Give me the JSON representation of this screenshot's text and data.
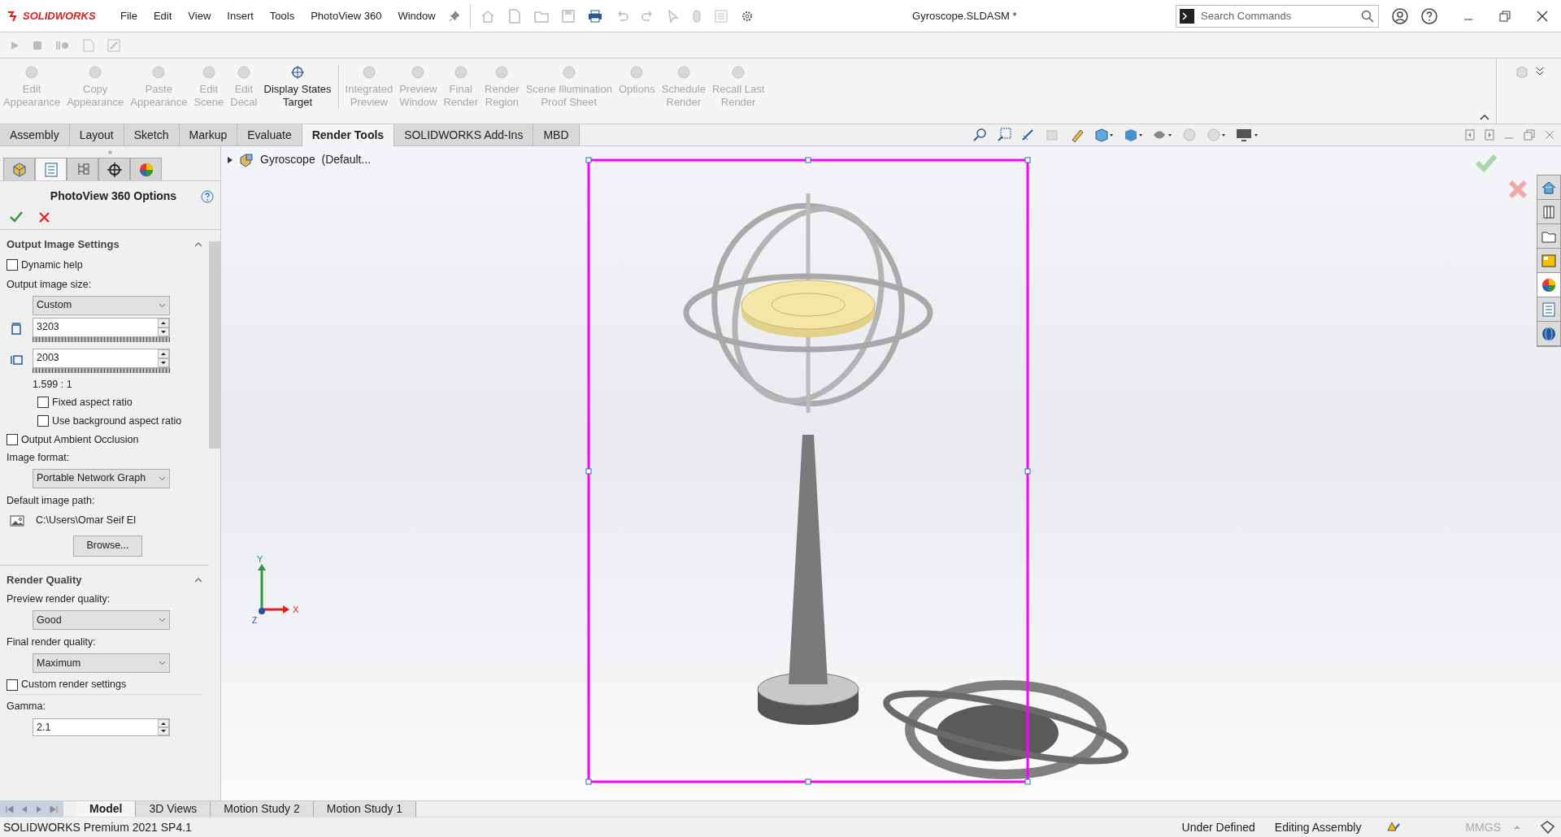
{
  "app": {
    "logo": "SOLIDWORKS",
    "menu": [
      "File",
      "Edit",
      "View",
      "Insert",
      "Tools",
      "PhotoView 360",
      "Window"
    ],
    "document_title": "Gyroscope.SLDASM *",
    "search": {
      "placeholder": "Search Commands"
    }
  },
  "ribbon": [
    {
      "label": "Edit Appearance",
      "disabled": true
    },
    {
      "label": "Copy Appearance",
      "disabled": true
    },
    {
      "label": "Paste Appearance",
      "disabled": true
    },
    {
      "label": "Edit Scene",
      "disabled": true
    },
    {
      "label": "Edit Decal",
      "disabled": true
    },
    {
      "label": "Display States Target",
      "disabled": false
    },
    {
      "label": "Integrated Preview",
      "disabled": true
    },
    {
      "label": "Preview Window",
      "disabled": true
    },
    {
      "label": "Final Render",
      "disabled": true
    },
    {
      "label": "Render Region",
      "disabled": true
    },
    {
      "label": "Scene Illumination Proof Sheet",
      "disabled": true
    },
    {
      "label": "Options",
      "disabled": true
    },
    {
      "label": "Schedule Render",
      "disabled": true
    },
    {
      "label": "Recall Last Render",
      "disabled": true
    }
  ],
  "command_tabs": [
    {
      "label": "Assembly",
      "selected": false
    },
    {
      "label": "Layout",
      "selected": false
    },
    {
      "label": "Sketch",
      "selected": false
    },
    {
      "label": "Markup",
      "selected": false
    },
    {
      "label": "Evaluate",
      "selected": false
    },
    {
      "label": "Render Tools",
      "selected": true
    },
    {
      "label": "SOLIDWORKS Add-Ins",
      "selected": false
    },
    {
      "label": "MBD",
      "selected": false
    }
  ],
  "panel_tabs": [
    {
      "selected": false
    },
    {
      "selected": true
    },
    {
      "selected": false
    },
    {
      "selected": false
    },
    {
      "selected": false
    }
  ],
  "property_manager": {
    "title": "PhotoView 360 Options",
    "output_image_settings": {
      "heading": "Output Image Settings",
      "dynamic_help": {
        "label": "Dynamic help",
        "checked": false
      },
      "size_label": "Output image size:",
      "size_value": "Custom",
      "height_value": "3203",
      "width_value": "2003",
      "ratio": "1.599 : 1",
      "fixed_aspect": {
        "label": "Fixed aspect ratio",
        "checked": false
      },
      "background_aspect": {
        "label": "Use background aspect ratio",
        "checked": false
      },
      "ambient_occlusion": {
        "label": "Output Ambient Occlusion",
        "checked": false
      },
      "format_label": "Image format:",
      "format_value": "Portable Network Graph",
      "path_label": "Default image path:",
      "path_value": "C:\\Users\\Omar Seif El",
      "browse": "Browse..."
    },
    "render_quality": {
      "heading": "Render Quality",
      "preview_label": "Preview render quality:",
      "preview_value": "Good",
      "final_label": "Final render quality:",
      "final_value": "Maximum",
      "custom_settings": {
        "label": "Custom render settings",
        "checked": false
      },
      "gamma_label": "Gamma:",
      "gamma_value": "2.1"
    }
  },
  "viewport": {
    "tree_item": "Gyroscope  (Default...",
    "axes": {
      "x": "X",
      "y": "Y",
      "z": "Z"
    }
  },
  "task_pane": [
    {
      "selected": false
    },
    {
      "selected": false
    },
    {
      "selected": false
    },
    {
      "selected": false
    },
    {
      "selected": true
    },
    {
      "selected": false
    },
    {
      "selected": false
    }
  ],
  "bottom_tabs": [
    {
      "label": "Model",
      "selected": true
    },
    {
      "label": "3D Views",
      "selected": false
    },
    {
      "label": "Motion Study 2",
      "selected": false
    },
    {
      "label": "Motion Study 1",
      "selected": false
    }
  ],
  "status_bar": {
    "product": "SOLIDWORKS Premium 2021 SP4.1",
    "definition": "Under Defined",
    "mode": "Editing Assembly",
    "units": "MMGS"
  }
}
